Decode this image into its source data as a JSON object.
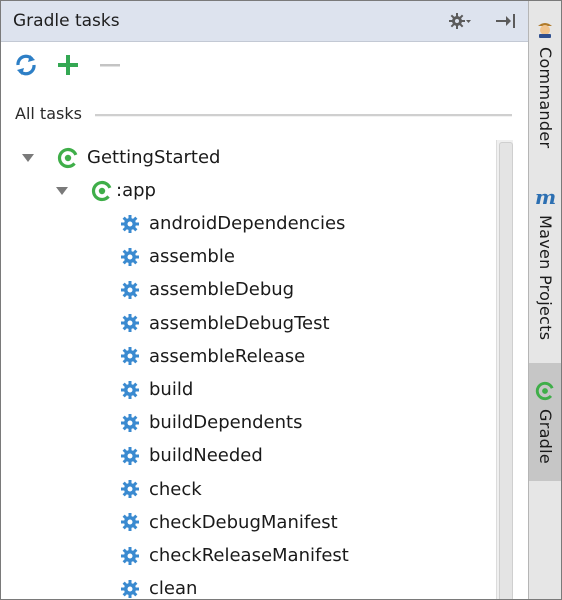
{
  "panel": {
    "title": "Gradle tasks",
    "settings_icon": "gear-dropdown-icon",
    "hide_icon": "hide-panel-icon"
  },
  "toolbar": {
    "refresh_icon": "refresh-icon",
    "add_icon": "add-icon",
    "remove_icon": "remove-icon"
  },
  "section": {
    "label": "All tasks"
  },
  "tree": {
    "root": {
      "label": "GettingStarted",
      "icon": "gradle-icon",
      "expanded": true
    },
    "module": {
      "label": ":app",
      "icon": "gradle-icon",
      "expanded": true
    },
    "tasks": [
      "androidDependencies",
      "assemble",
      "assembleDebug",
      "assembleDebugTest",
      "assembleRelease",
      "build",
      "buildDependents",
      "buildNeeded",
      "check",
      "checkDebugManifest",
      "checkReleaseManifest",
      "clean"
    ]
  },
  "side_strip": {
    "items": [
      {
        "label": "Commander",
        "icon": "commander-icon",
        "active": false
      },
      {
        "label": "Maven Projects",
        "icon": "maven-icon",
        "active": false
      },
      {
        "label": "Gradle",
        "icon": "gradle-icon",
        "active": true
      }
    ]
  },
  "colors": {
    "title_bar": "#dde3ee",
    "gradle_green": "#3fae49",
    "refresh_blue": "#2d7fc6",
    "gear_blue": "#3a8ad0",
    "add_green": "#34a853",
    "active_tab": "#c6c6c6"
  }
}
